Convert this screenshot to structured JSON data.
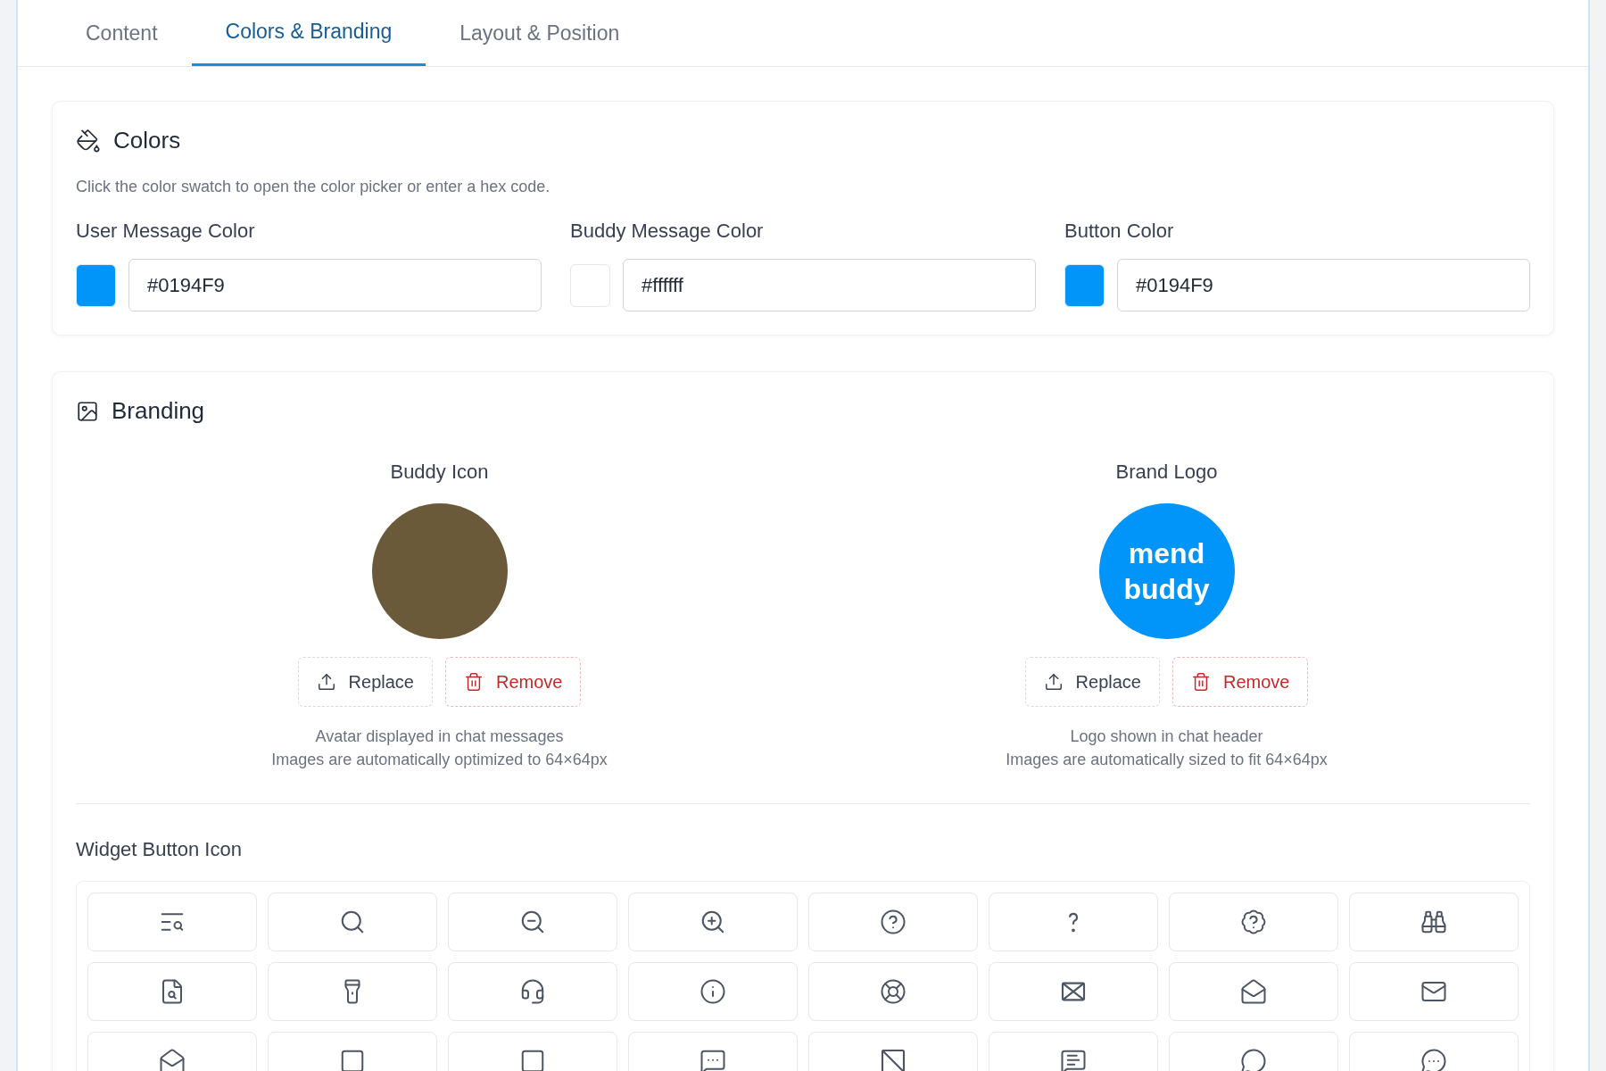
{
  "tabs": [
    {
      "label": "Content",
      "selected": false
    },
    {
      "label": "Colors & Branding",
      "selected": true
    },
    {
      "label": "Layout & Position",
      "selected": false
    }
  ],
  "colors": {
    "title": "Colors",
    "hint": "Click the color swatch to open the color picker or enter a hex code.",
    "fields": [
      {
        "label": "User Message Color",
        "value": "#0194F9",
        "color": "#0194f9"
      },
      {
        "label": "Buddy Message Color",
        "value": "#ffffff",
        "color": "#ffffff"
      },
      {
        "label": "Button Color",
        "value": "#0194F9",
        "color": "#0194f9"
      }
    ]
  },
  "branding": {
    "title": "Branding",
    "images": [
      {
        "kind": "avatar",
        "label": "Buddy Icon",
        "buttons": [
          {
            "kind": "replace",
            "label": "Replace"
          },
          {
            "kind": "remove",
            "label": "Remove"
          }
        ],
        "caption": [
          "Avatar displayed in chat messages",
          "Images are automatically optimized to 64×64px"
        ]
      },
      {
        "kind": "logo",
        "label": "Brand Logo",
        "logo_text": [
          "mend",
          "buddy"
        ],
        "buttons": [
          {
            "kind": "replace",
            "label": "Replace"
          },
          {
            "kind": "remove",
            "label": "Remove"
          }
        ],
        "caption": [
          "Logo shown in chat header",
          "Images are automatically sized to fit 64×64px"
        ]
      }
    ],
    "widget_icon": {
      "title": "Widget Button Icon"
    }
  }
}
